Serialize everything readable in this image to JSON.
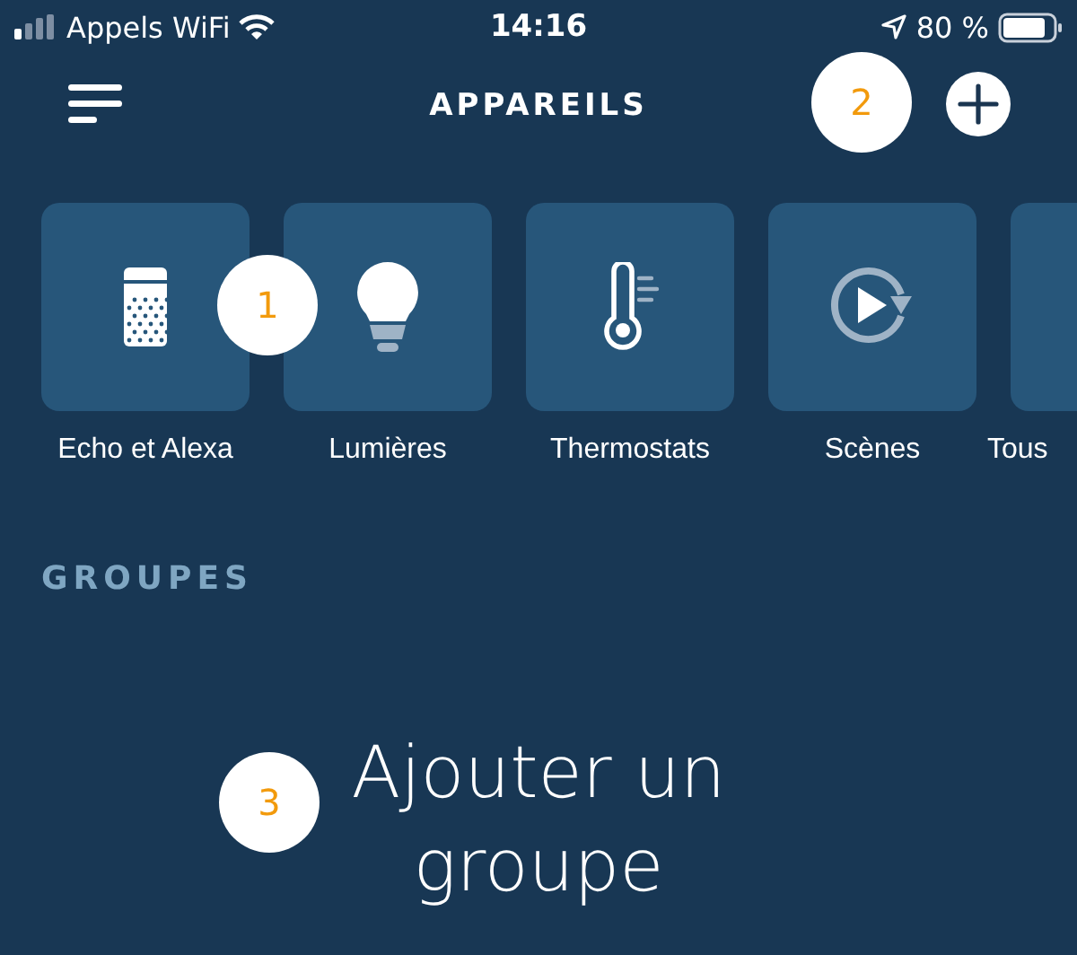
{
  "status_bar": {
    "carrier": "Appels WiFi",
    "time": "14:16",
    "battery": "80 %"
  },
  "header": {
    "title": "APPAREILS"
  },
  "categories": [
    {
      "kind": "speaker",
      "label": "Echo et Alexa"
    },
    {
      "kind": "bulb",
      "label": "Lumières"
    },
    {
      "kind": "thermostat",
      "label": "Thermostats"
    },
    {
      "kind": "scene",
      "label": "Scènes"
    },
    {
      "kind": "all",
      "label": "Tous"
    }
  ],
  "section": {
    "title": "GROUPES"
  },
  "empty_state": {
    "text": "Ajouter un groupe"
  },
  "callouts": [
    {
      "label": "1"
    },
    {
      "label": "2"
    },
    {
      "label": "3"
    }
  ]
}
